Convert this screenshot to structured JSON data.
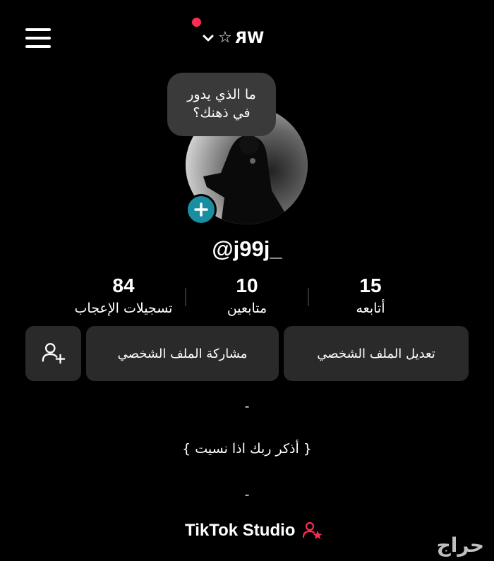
{
  "header": {
    "account_name": "WR",
    "star_glyph": "☆",
    "has_notification": true
  },
  "profile": {
    "note_line1": "ما الذي يدور",
    "note_line2": "في ذهنك؟",
    "handle": "@j99j_"
  },
  "stats": {
    "likes": {
      "value": "84",
      "label": "تسجيلات الإعجاب"
    },
    "followers": {
      "value": "10",
      "label": "متابعين"
    },
    "following": {
      "value": "15",
      "label": "أتابعه"
    }
  },
  "actions": {
    "edit_profile": "تعديل الملف الشخصي",
    "share_profile": "مشاركة الملف الشخصي",
    "add_friend_icon": "person-add-icon"
  },
  "bio": {
    "line1": "-",
    "line2": "{ أذكر ربك اذا نسيت }",
    "line3": "-"
  },
  "studio": {
    "label": "TikTok Studio",
    "icon": "studio-user-star-icon",
    "accent": "#fe2c55"
  },
  "watermark": {
    "text": "حراج"
  },
  "colors": {
    "background": "#000000",
    "button_bg": "#2a2a2a",
    "add_button": "#1a8ea0",
    "notification_dot": "#fe2c55"
  }
}
